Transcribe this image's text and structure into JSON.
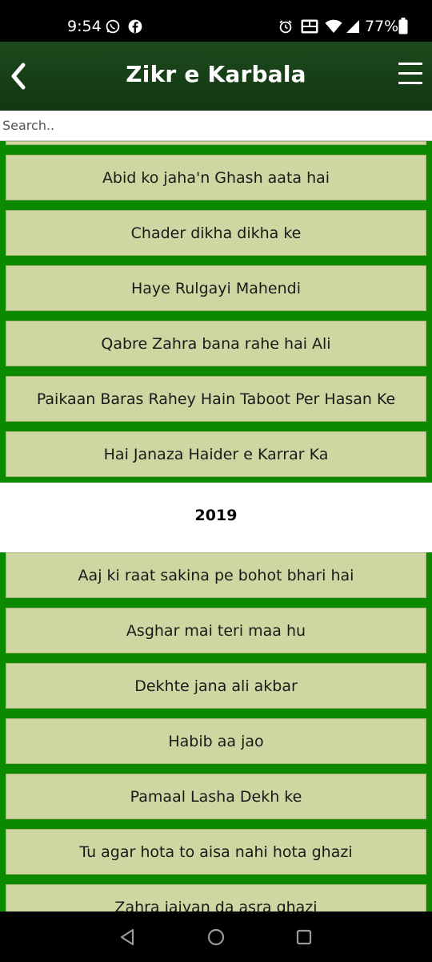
{
  "status_bar": {
    "time": "9:54",
    "battery": "77%",
    "icons": [
      "whatsapp-icon",
      "facebook-icon",
      "alarm-icon",
      "vowifi-icon",
      "wifi-icon",
      "signal-icon",
      "battery-icon"
    ]
  },
  "header": {
    "title": "Zikr e Karbala",
    "back_icon": "chevron-left-icon",
    "menu_icon": "hamburger-menu-icon",
    "background_color": "#133a13"
  },
  "search": {
    "placeholder": "Search..",
    "value": ""
  },
  "list": {
    "accent_color": "#0b8a00",
    "item_color": "#cfd6a1",
    "section_a_items": [
      "Abid ko jaha'n Ghash aata hai",
      "Chader dikha dikha ke",
      "Haye Rulgayi Mahendi",
      "Qabre Zahra bana rahe hai Ali",
      "Paikaan Baras Rahey Hain Taboot Per Hasan Ke",
      "Hai Janaza Haider e Karrar Ka"
    ],
    "section_b_heading": "2019",
    "section_b_items": [
      "Aaj ki raat sakina pe bohot bhari hai",
      "Asghar mai teri maa hu",
      "Dekhte jana ali akbar",
      "Habib aa jao",
      "Pamaal Lasha Dekh ke",
      "Tu agar hota to aisa nahi hota ghazi",
      "Zahra jaiyan da asra ghazi"
    ]
  },
  "nav_bar": {
    "icons": [
      "back-triangle-icon",
      "home-circle-icon",
      "recents-square-icon"
    ]
  }
}
